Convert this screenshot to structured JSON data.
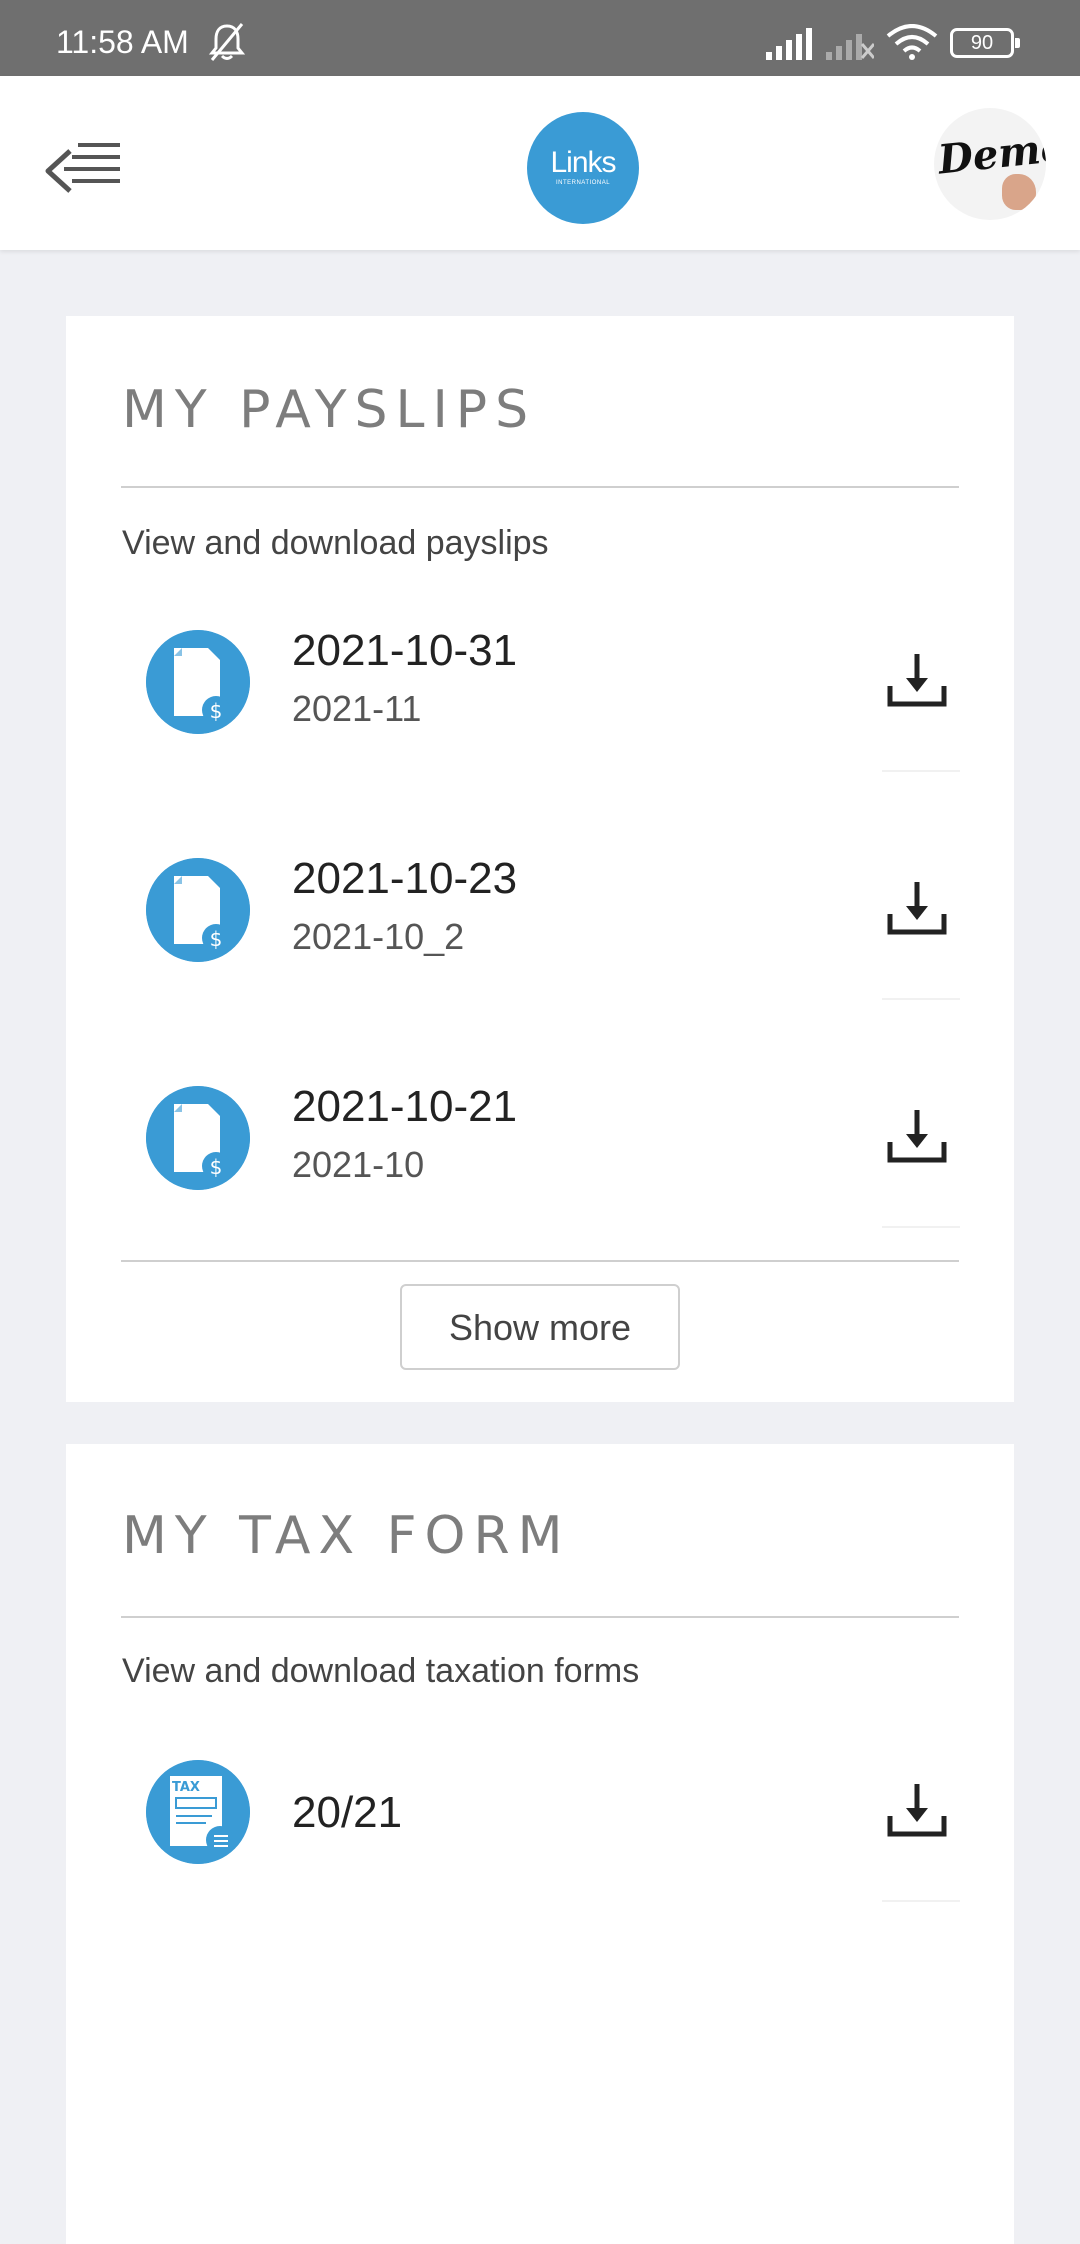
{
  "status_bar": {
    "time": "11:58 AM",
    "battery": "90",
    "icons": [
      "bell-off-icon",
      "signal-icon",
      "signal-no-service-icon",
      "wifi-icon",
      "battery-icon"
    ]
  },
  "header": {
    "menu_icon": "menu-collapse-icon",
    "logo_text": "Links",
    "logo_subtext": "INTERNATIONAL",
    "avatar_text": "Demo"
  },
  "payslips": {
    "title": "MY PAYSLIPS",
    "subtitle": "View and download payslips",
    "items": [
      {
        "date": "2021-10-31",
        "period": "2021-11"
      },
      {
        "date": "2021-10-23",
        "period": "2021-10_2"
      },
      {
        "date": "2021-10-21",
        "period": "2021-10"
      }
    ],
    "show_more_label": "Show more"
  },
  "tax_forms": {
    "title": "MY TAX FORM",
    "subtitle": "View and download taxation forms",
    "items": [
      {
        "year": "20/21",
        "icon_label": "TAX"
      }
    ]
  },
  "colors": {
    "accent": "#3a9bd5",
    "status_bar": "#6f6f6f",
    "background": "#eff0f4"
  }
}
